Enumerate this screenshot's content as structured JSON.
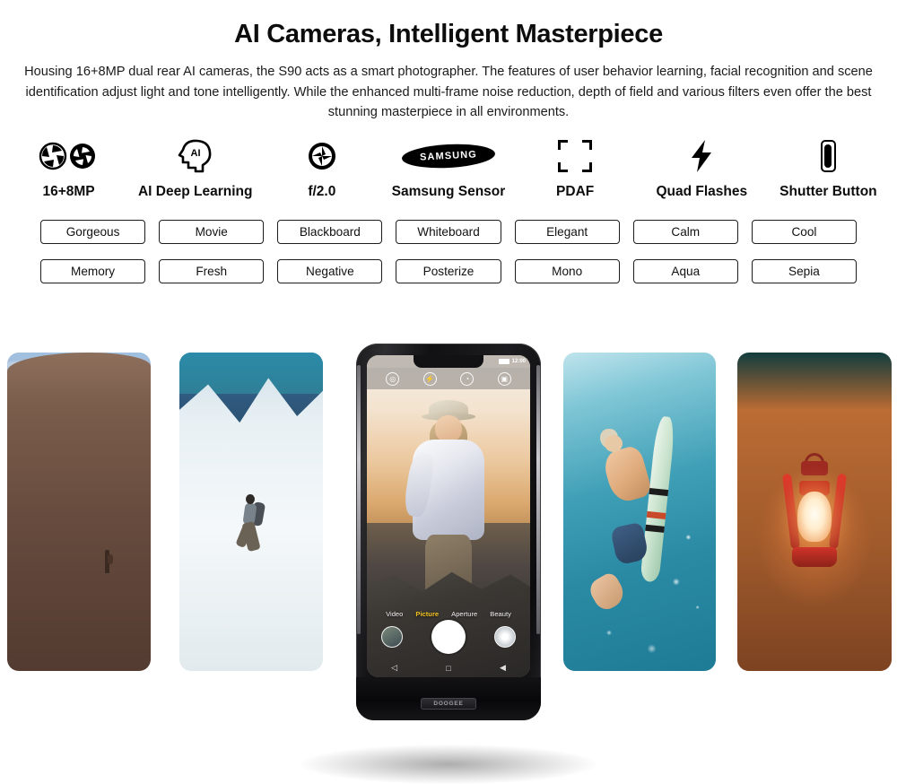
{
  "header": {
    "title": "AI Cameras, Intelligent Masterpiece",
    "paragraph": "Housing 16+8MP dual rear AI cameras, the S90 acts as a smart photographer. The features of user behavior learning, facial recognition and scene identification adjust light and tone intelligently. While the enhanced multi-frame noise reduction, depth of field and various filters even offer the best stunning masterpiece in all environments."
  },
  "features": [
    {
      "label": "16+8MP",
      "icon": "dual-aperture-icon"
    },
    {
      "label": "AI Deep Learning",
      "icon": "ai-head-icon"
    },
    {
      "label": "f/2.0",
      "icon": "aperture-wheel-icon"
    },
    {
      "label": "Samsung Sensor",
      "icon": "samsung-logo-icon",
      "logo_text": "SAMSUNG"
    },
    {
      "label": "PDAF",
      "icon": "focus-brackets-icon"
    },
    {
      "label": "Quad Flashes",
      "icon": "lightning-bolt-icon"
    },
    {
      "label": "Shutter Button",
      "icon": "shutter-button-icon"
    }
  ],
  "filters": [
    "Gorgeous",
    "Movie",
    "Blackboard",
    "Whiteboard",
    "Elegant",
    "Calm",
    "Cool",
    "Memory",
    "Fresh",
    "Negative",
    "Posterize",
    "Mono",
    "Aqua",
    "Sepia"
  ],
  "phone": {
    "status": {
      "time": "12:00"
    },
    "top_controls": [
      {
        "name": "hdr-settings-icon",
        "glyph": "◎"
      },
      {
        "name": "flash-icon",
        "glyph": "⚡"
      },
      {
        "name": "timer-icon",
        "glyph": "◔"
      },
      {
        "name": "camera-switch-icon",
        "glyph": "▣"
      }
    ],
    "modes": [
      {
        "label": "Video",
        "active": false
      },
      {
        "label": "Picture",
        "active": true
      },
      {
        "label": "Aperture",
        "active": false
      },
      {
        "label": "Beauty",
        "active": false
      }
    ],
    "nav": [
      {
        "name": "back-nav-icon",
        "glyph": "◁"
      },
      {
        "name": "home-nav-icon",
        "glyph": "□"
      },
      {
        "name": "recents-nav-icon",
        "glyph": "◀"
      }
    ],
    "brand": "DOOGEE"
  },
  "gallery": [
    {
      "name": "desert-sunset-photo",
      "caption": "Desert sunset with lone hiker"
    },
    {
      "name": "mountain-hiker-photo",
      "caption": "Hiker on snowy mountain ridge"
    },
    {
      "name": "underwater-surfer-photo",
      "caption": "Surfer diving underwater with board"
    },
    {
      "name": "red-lantern-photo",
      "caption": "Red oil lantern glowing on sand"
    }
  ],
  "colors": {
    "accent": "#f4c320",
    "text": "#111111",
    "chip_border": "#1d1d1d",
    "background": "#ffffff"
  }
}
